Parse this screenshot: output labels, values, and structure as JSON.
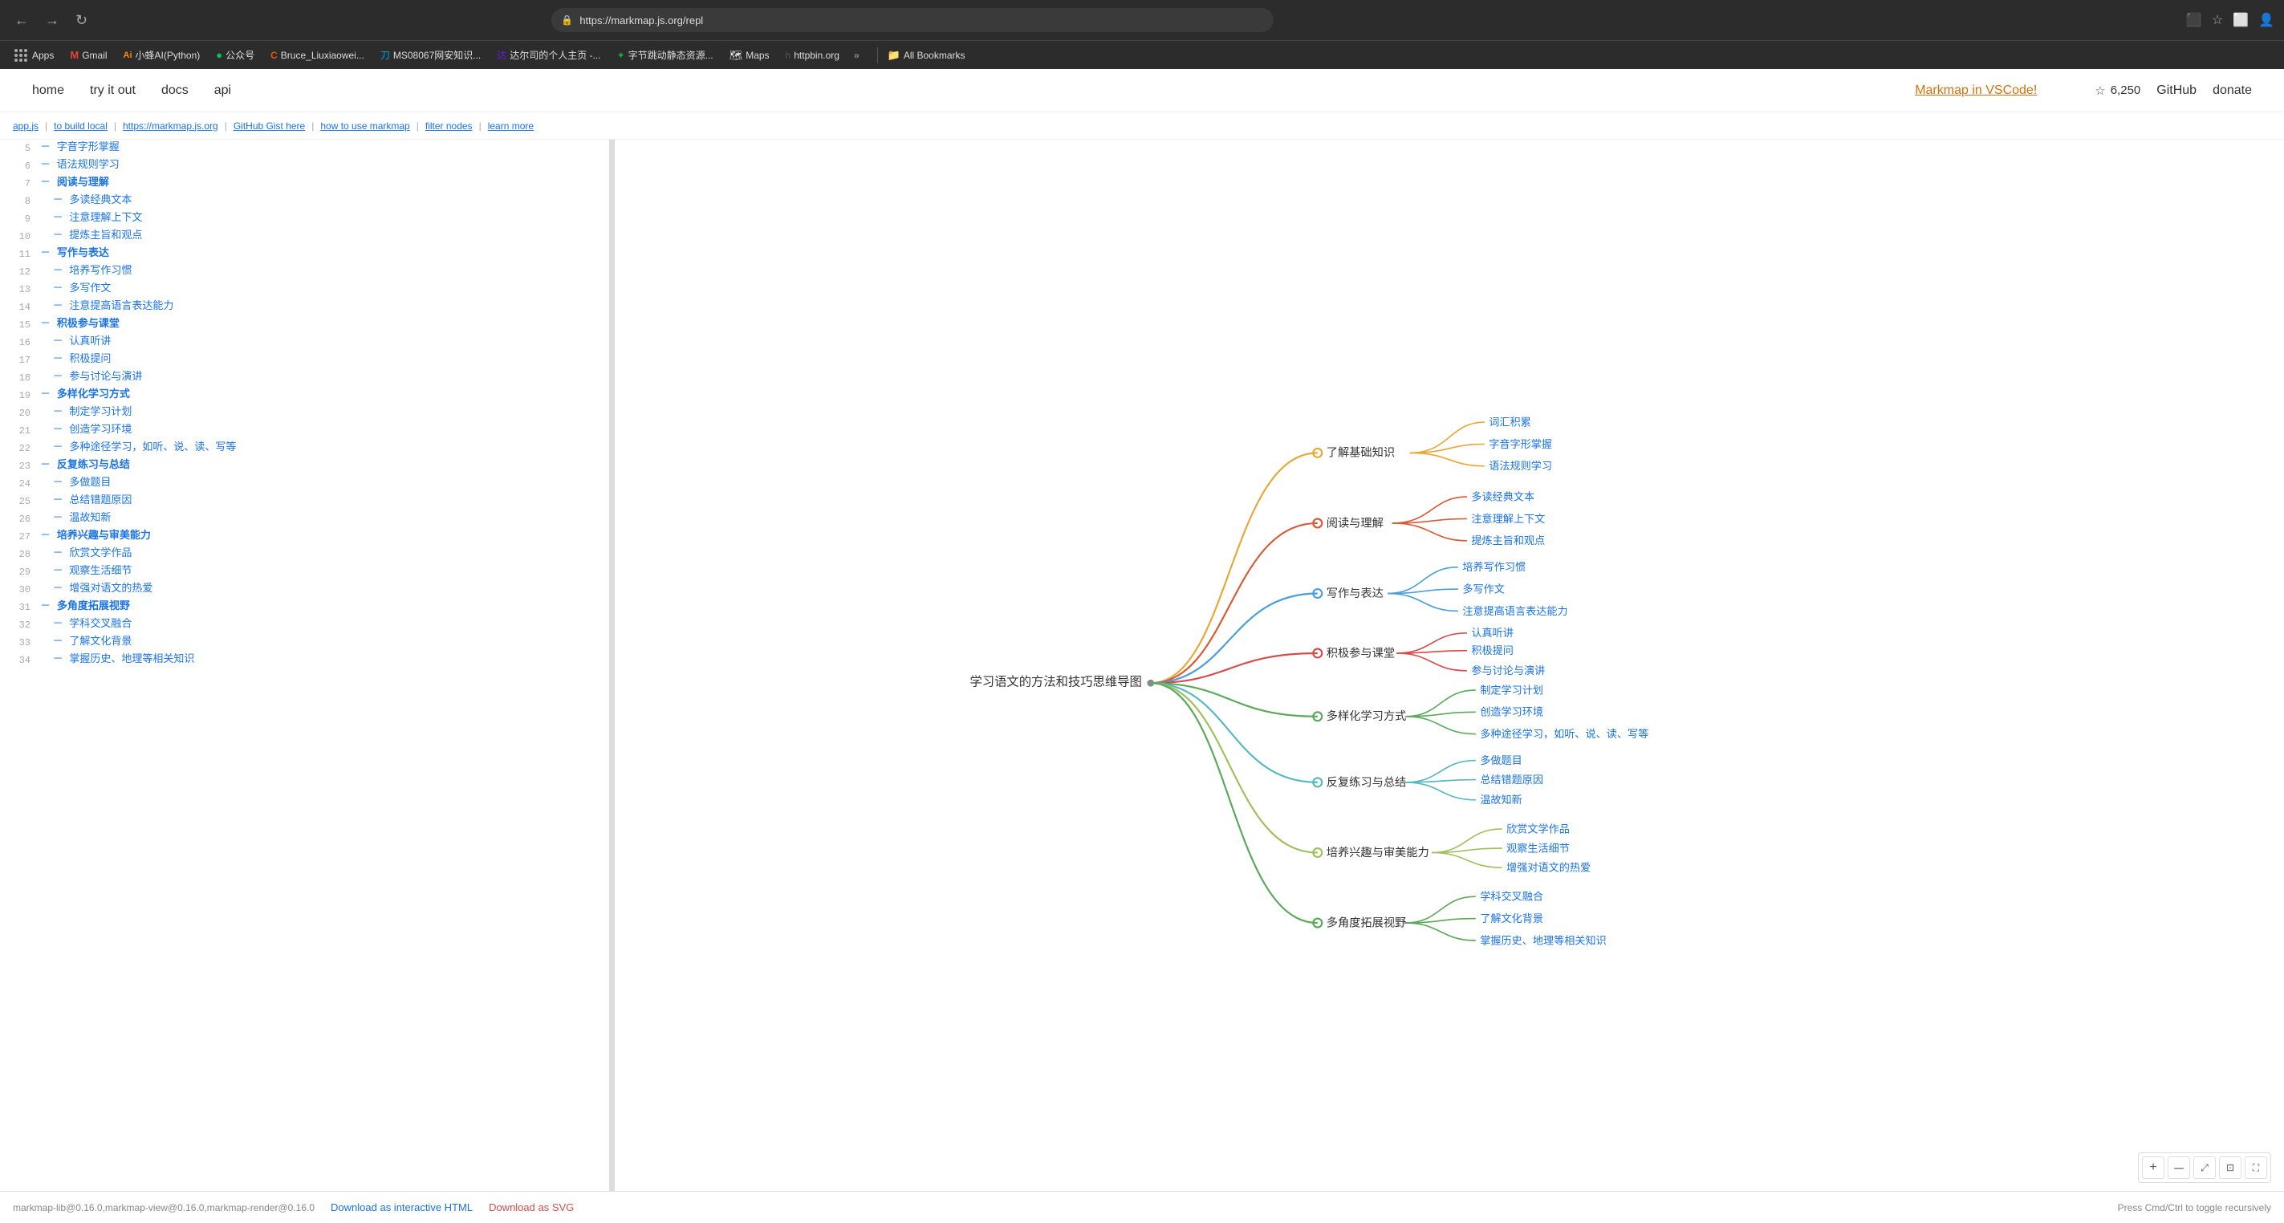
{
  "browser": {
    "url": "https://markmap.js.org/repl",
    "back_label": "←",
    "forward_label": "→",
    "refresh_label": "↻",
    "bookmarks": [
      {
        "label": "Apps",
        "icon_class": "bm-apps",
        "icon_text": "⊞"
      },
      {
        "label": "Gmail",
        "icon_class": "bm-gmail",
        "icon_text": "M"
      },
      {
        "label": "小蜂AI(Python)",
        "icon_class": "bm-ai",
        "icon_text": "Ai"
      },
      {
        "label": "公众号",
        "icon_class": "bm-gzh",
        "icon_text": "●"
      },
      {
        "label": "Bruce_Liuxiaowei...",
        "icon_class": "bm-bruce",
        "icon_text": "C"
      },
      {
        "label": "MS08067网安知识...",
        "icon_class": "bm-ms",
        "icon_text": "刀"
      },
      {
        "label": "达尔司的个人主页 -...",
        "icon_class": "bm-da",
        "icon_text": "达"
      },
      {
        "label": "字节跳动静态资源...",
        "icon_class": "bm-zi",
        "icon_text": "✦"
      },
      {
        "label": "Maps",
        "icon_class": "bm-maps",
        "icon_text": "🗺"
      },
      {
        "label": "httpbin.org",
        "icon_class": "bm-http",
        "icon_text": "h"
      },
      {
        "label": "»",
        "icon_class": "bm-more"
      },
      {
        "label": "All Bookmarks",
        "icon_class": "bm-all-bookmarks"
      }
    ]
  },
  "nav": {
    "home": "home",
    "try_it_out": "try it out",
    "docs": "docs",
    "api": "api",
    "vscode_link": "Markmap in VSCode!",
    "star_icon": "★",
    "star_count": "6,250",
    "github": "GitHub",
    "donate": "donate"
  },
  "breadcrumb": {
    "links": [
      "app.js",
      "to build local",
      "https://markmap.js.org",
      "GitHub Gist here",
      "how to use markmap",
      "filter nodes",
      "learn more"
    ]
  },
  "editor": {
    "lines": [
      {
        "num": 5,
        "content": "－ 字音字形掌握"
      },
      {
        "num": 6,
        "content": "－ 语法规则学习"
      },
      {
        "num": 7,
        "content": "－ **阅读与理解**"
      },
      {
        "num": 8,
        "content": "  － 多读经典文本"
      },
      {
        "num": 9,
        "content": "  － 注意理解上下文"
      },
      {
        "num": 10,
        "content": "  － 提炼主旨和观点"
      },
      {
        "num": 11,
        "content": "－ **写作与表达**"
      },
      {
        "num": 12,
        "content": "  － 培养写作习惯"
      },
      {
        "num": 13,
        "content": "  － 多写作文"
      },
      {
        "num": 14,
        "content": "  － 注意提高语言表达能力"
      },
      {
        "num": 15,
        "content": "－ **积极参与课堂**"
      },
      {
        "num": 16,
        "content": "  － 认真听讲"
      },
      {
        "num": 17,
        "content": "  － 积极提问"
      },
      {
        "num": 18,
        "content": "  － 参与讨论与演讲"
      },
      {
        "num": 19,
        "content": "－ **多样化学习方式**"
      },
      {
        "num": 20,
        "content": "  － 制定学习计划"
      },
      {
        "num": 21,
        "content": "  － 创造学习环境"
      },
      {
        "num": 22,
        "content": "  － 多种途径学习，如听、说、读、写等"
      },
      {
        "num": 23,
        "content": "－ **反复练习与总结**"
      },
      {
        "num": 24,
        "content": "  － 多做题目"
      },
      {
        "num": 25,
        "content": "  － 总结错题原因"
      },
      {
        "num": 26,
        "content": "  － 温故知新"
      },
      {
        "num": 27,
        "content": "－ **培养兴趣与审美能力**"
      },
      {
        "num": 28,
        "content": "  － 欣赏文学作品"
      },
      {
        "num": 29,
        "content": "  － 观察生活细节"
      },
      {
        "num": 30,
        "content": "  － 增强对语文的热爱"
      },
      {
        "num": 31,
        "content": "－ **多角度拓展视野**"
      },
      {
        "num": 32,
        "content": "  － 学科交叉融合"
      },
      {
        "num": 33,
        "content": "  － 了解文化背景"
      },
      {
        "num": 34,
        "content": "  － 掌握历史、地理等相关知识"
      }
    ]
  },
  "mindmap": {
    "root": "学习语文的方法和技巧思维导图",
    "branches": [
      {
        "label": "了解基础知识",
        "color": "#e8a838",
        "children": [
          "词汇积累",
          "字音字形掌握",
          "语法规则学习"
        ]
      },
      {
        "label": "阅读与理解",
        "color": "#d75c37",
        "children": [
          "多读经典文本",
          "注意理解上下文",
          "提炼主旨和观点"
        ]
      },
      {
        "label": "写作与表达",
        "color": "#4a9eda",
        "children": [
          "培养写作习惯",
          "多写作文",
          "注意提高语言表达能力"
        ]
      },
      {
        "label": "积极参与课堂",
        "color": "#d44d4d",
        "children": [
          "认真听讲",
          "积极提问",
          "参与讨论与演讲"
        ]
      },
      {
        "label": "多样化学习方式",
        "color": "#5aaa5a",
        "children": [
          "制定学习计划",
          "创造学习环境",
          "多种途径学习，如听、说、读、写等"
        ]
      },
      {
        "label": "反复练习与总结",
        "color": "#56b8c0",
        "children": [
          "多做题目",
          "总结错题原因",
          "温故知新"
        ]
      },
      {
        "label": "培养兴趣与审美能力",
        "color": "#a0c060",
        "children": [
          "欣赏文学作品",
          "观察生活细节",
          "增强对语文的热爱"
        ]
      },
      {
        "label": "多角度拓展视野",
        "color": "#5aaa5a",
        "children": [
          "学科交叉融合",
          "了解文化背景",
          "掌握历史、地理等相关知识"
        ]
      }
    ]
  },
  "bottom": {
    "version": "markmap-lib@0.16.0,markmap-view@0.16.0,markmap-render@0.16.0",
    "download_html": "Download as interactive HTML",
    "download_svg": "Download as SVG",
    "shortcut_hint": "Press Cmd/Ctrl to toggle recursively",
    "zoom_plus": "+",
    "zoom_minus": "－",
    "zoom_fit1": "⤢",
    "zoom_fit2": "⊡",
    "zoom_fullscreen": "⛶"
  }
}
